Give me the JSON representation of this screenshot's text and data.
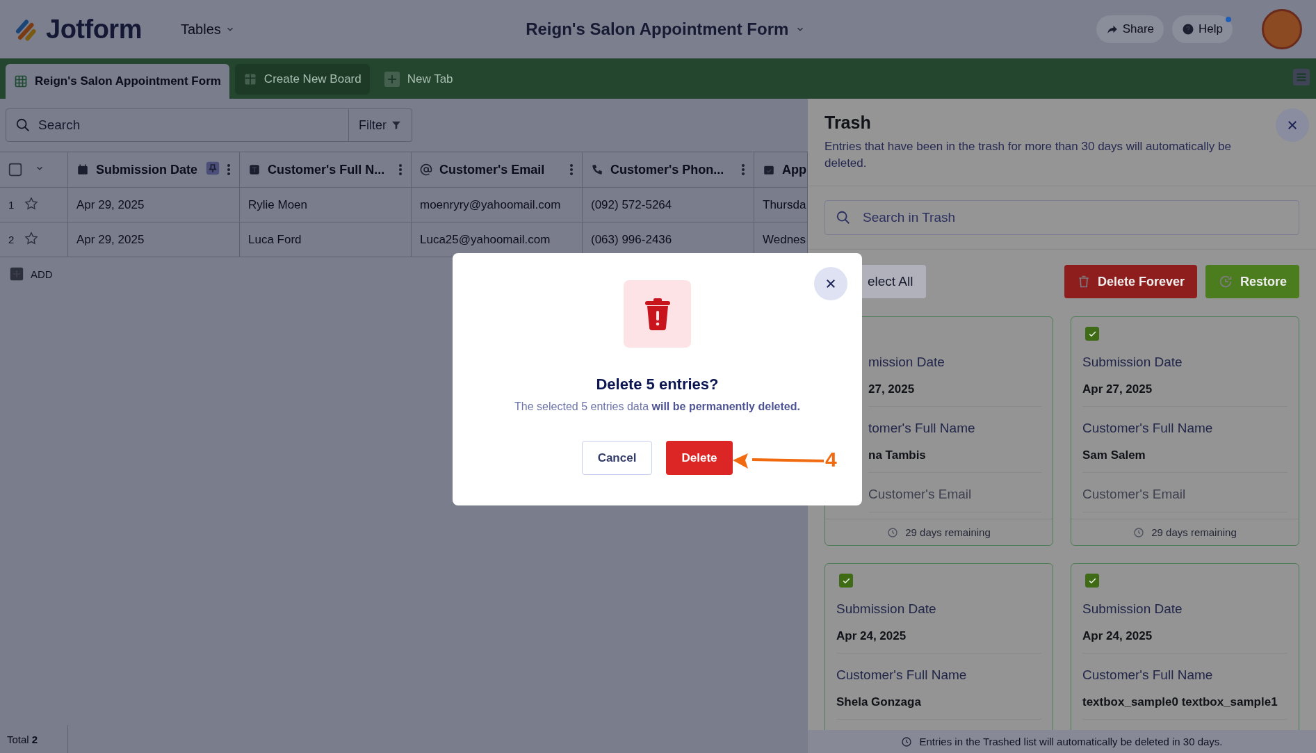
{
  "header": {
    "logo": "Jotform",
    "menu": "Tables",
    "title": "Reign's Salon Appointment Form",
    "share": "Share",
    "help": "Help",
    "help_badge": true
  },
  "tabs": [
    {
      "label": "Reign's Salon Appointment Form",
      "selected": true,
      "kind": "table"
    },
    {
      "label": "Create New Board",
      "selected": false,
      "kind": "board"
    },
    {
      "label": "New Tab",
      "selected": false,
      "kind": "add"
    }
  ],
  "toolbar": {
    "search_placeholder": "Search",
    "filter": "Filter"
  },
  "table": {
    "select_all_checked": false,
    "columns": [
      {
        "label": "Submission Date",
        "kind": "date",
        "pinned": true
      },
      {
        "label": "Customer's Full N...",
        "kind": "text",
        "pinned": false
      },
      {
        "label": "Customer's Email",
        "kind": "email",
        "pinned": false
      },
      {
        "label": "Customer's Phon...",
        "kind": "phone",
        "pinned": false
      },
      {
        "label": "App",
        "kind": "appointment",
        "pinned": false
      }
    ],
    "rows": [
      {
        "number": "1",
        "starred": false,
        "cells": [
          "Apr 29, 2025",
          "Rylie Moen",
          "moenryry@yahoomail.com",
          "(092) 572-5264",
          "Thursda"
        ]
      },
      {
        "number": "2",
        "starred": false,
        "cells": [
          "Apr 29, 2025",
          "Luca Ford",
          "Luca25@yahoomail.com",
          "(063) 996-2436",
          "Wednes"
        ]
      }
    ],
    "add": "ADD"
  },
  "status_bar": {
    "total": "Total **2**"
  },
  "trash": {
    "title": "Trash",
    "description": "Entries that have been in the trash for more than 30 days will automatically be deleted.",
    "search_placeholder": "Search in Trash",
    "select_all": "elect All",
    "delete_forever": "Delete Forever",
    "restore": "Restore",
    "cards": [
      {
        "fields": [
          {
            "label": "mission Date",
            "value": "27, 2025"
          },
          {
            "label": "tomer's Full Name",
            "value": "na Tambis"
          },
          {
            "label": "Customer's Email"
          }
        ],
        "remaining": "29 days remaining"
      },
      {
        "checked": true,
        "fields": [
          {
            "label": "Submission Date",
            "value": "Apr 27, 2025"
          },
          {
            "label": "Customer's Full Name",
            "value": "Sam Salem"
          },
          {
            "label": "Customer's Email"
          }
        ],
        "remaining": "29 days remaining"
      },
      {
        "checked": true,
        "fields": [
          {
            "label": "Submission Date",
            "value": "Apr 24, 2025"
          },
          {
            "label": "Customer's Full Name",
            "value": "Shela Gonzaga"
          }
        ]
      },
      {
        "checked": true,
        "fields": [
          {
            "label": "Submission Date",
            "value": "Apr 24, 2025"
          },
          {
            "label": "Customer's Full Name",
            "value": "textbox_sample0 textbox_sample1"
          }
        ]
      }
    ],
    "footer": "Entries in the Trashed list will automatically be deleted in 30 days."
  },
  "modal": {
    "title": "Delete 5 entries?",
    "message": "The selected 5 entries data **will be permanently deleted.**",
    "cancel": "Cancel",
    "confirm": "Delete",
    "annotation": "4"
  }
}
